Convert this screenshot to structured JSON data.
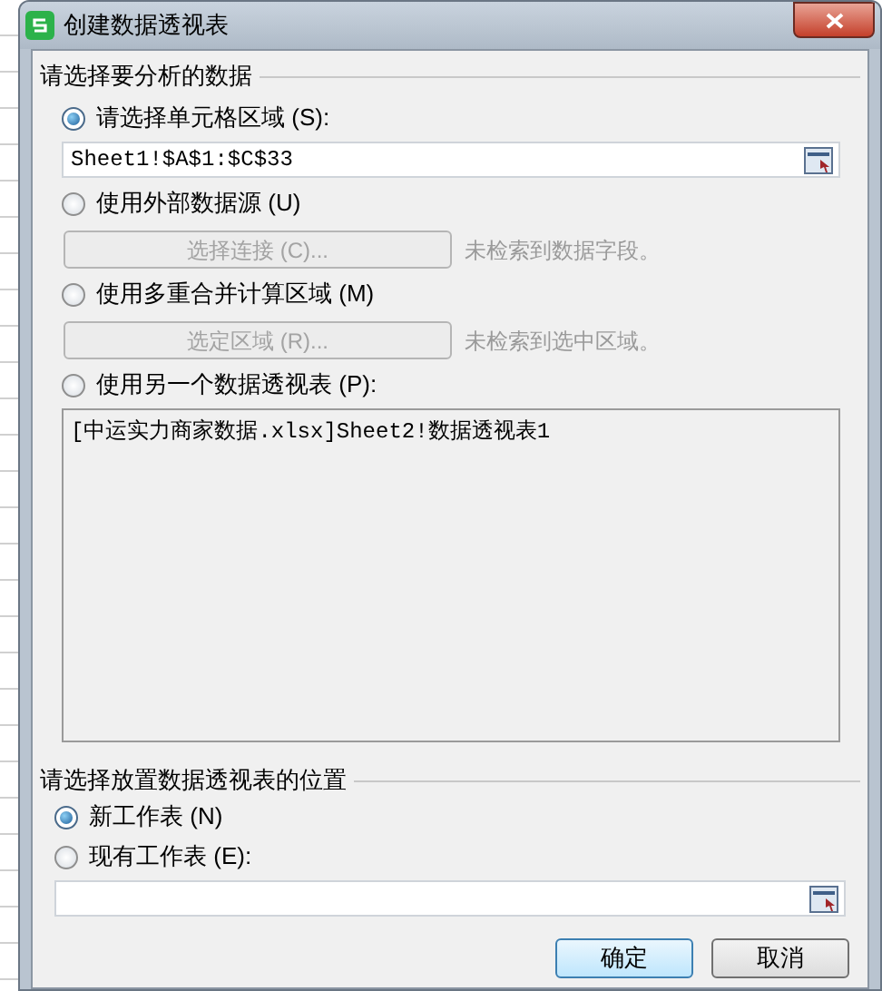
{
  "window": {
    "title": "创建数据透视表"
  },
  "source_section": {
    "title": "请选择要分析的数据",
    "options": [
      {
        "kind": "range",
        "label": "请选择单元格区域 (S):",
        "selected": true,
        "value": "Sheet1!$A$1:$C$33"
      },
      {
        "kind": "action",
        "label": "使用外部数据源 (U)",
        "selected": false,
        "button": {
          "label": "选择连接 (C)...",
          "disabled": true
        },
        "status": "未检索到数据字段。"
      },
      {
        "kind": "action",
        "label": "使用多重合并计算区域 (M)",
        "selected": false,
        "button": {
          "label": "选定区域 (R)...",
          "disabled": true
        },
        "status": "未检索到选中区域。"
      },
      {
        "kind": "listbox",
        "label": "使用另一个数据透视表 (P):",
        "selected": false,
        "items": [
          "[中运实力商家数据.xlsx]Sheet2!数据透视表1"
        ]
      }
    ]
  },
  "destination_section": {
    "title": "请选择放置数据透视表的位置",
    "options": [
      {
        "label": "新工作表 (N)",
        "selected": true
      },
      {
        "label": "现有工作表 (E):",
        "selected": false
      }
    ]
  },
  "buttons": [
    {
      "label": "确定",
      "default": true
    },
    {
      "label": "取消",
      "default": false
    }
  ]
}
